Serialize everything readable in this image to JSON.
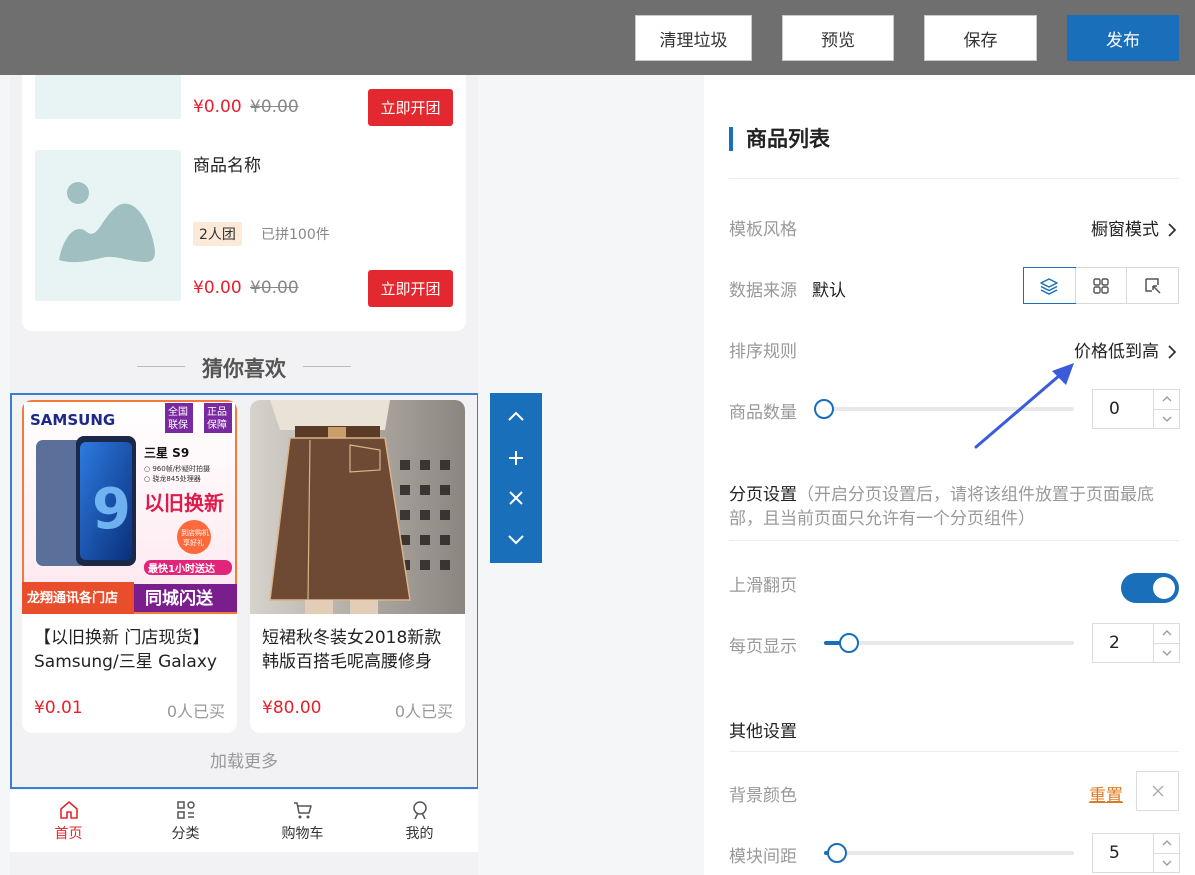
{
  "toolbar": {
    "clear_label": "清理垃圾",
    "preview_label": "预览",
    "save_label": "保存",
    "publish_label": "发布"
  },
  "group_items": [
    {
      "name": "",
      "price": "¥0.00",
      "old_price": "¥0.00",
      "button": "立即开团"
    },
    {
      "name": "商品名称",
      "tag": "2人团",
      "sold": "已拼100件",
      "price": "¥0.00",
      "old_price": "¥0.00",
      "button": "立即开团"
    }
  ],
  "guess": {
    "title": "猜你喜欢",
    "products": [
      {
        "title": "【以旧换新 门店现货】Samsung/三星 Galaxy S",
        "price": "¥0.01",
        "sold": "0人已买",
        "image": {
          "brand": "SAMSUNG",
          "badge1": "全国联保",
          "badge2": "正品保障",
          "model": "三星 S9",
          "spec1": "○ 960帧/秒疑时拍摄",
          "spec2": "○ 骁龙845处理器",
          "slogan": "以旧换新",
          "gift": "到店购机享好礼",
          "fast": "最快1小时送达",
          "store": "龙翔通讯各门店",
          "flash": "同城闪送"
        }
      },
      {
        "title": "短裙秋冬装女2018新款韩版百搭毛呢高腰修身",
        "price": "¥80.00",
        "sold": "0人已买"
      }
    ],
    "load_more": "加载更多"
  },
  "tabbar": [
    {
      "label": "首页",
      "icon": "home-icon",
      "active": true
    },
    {
      "label": "分类",
      "icon": "category-icon",
      "active": false
    },
    {
      "label": "购物车",
      "icon": "cart-icon",
      "active": false
    },
    {
      "label": "我的",
      "icon": "user-icon",
      "active": false
    }
  ],
  "panel": {
    "title": "商品列表",
    "template_style": {
      "label": "模板风格",
      "value": "橱窗模式"
    },
    "data_source": {
      "label": "数据来源",
      "value": "默认"
    },
    "sort_rule": {
      "label": "排序规则",
      "value": "价格低到高"
    },
    "goods_count": {
      "label": "商品数量",
      "value": "0",
      "slider_fraction": 0.0
    },
    "pagination": {
      "head": "分页设置",
      "note_line1": "（开启分页设置后，请将该组件放置于页面最底",
      "note_line2": "部，且当前页面只允许有一个分页组件）"
    },
    "slide_page": {
      "label": "上滑翻页",
      "on": true
    },
    "per_page": {
      "label": "每页显示",
      "value": "2",
      "slider_fraction": 0.1
    },
    "other": {
      "head": "其他设置"
    },
    "bg_color": {
      "label": "背景颜色",
      "reset": "重置"
    },
    "spacing": {
      "label": "模块间距",
      "value": "5",
      "slider_fraction": 0.05
    }
  },
  "colors": {
    "accent": "#1a6fba",
    "price_red": "#e6202c",
    "button_red": "#e3282f",
    "link_orange": "#e07a1e"
  }
}
